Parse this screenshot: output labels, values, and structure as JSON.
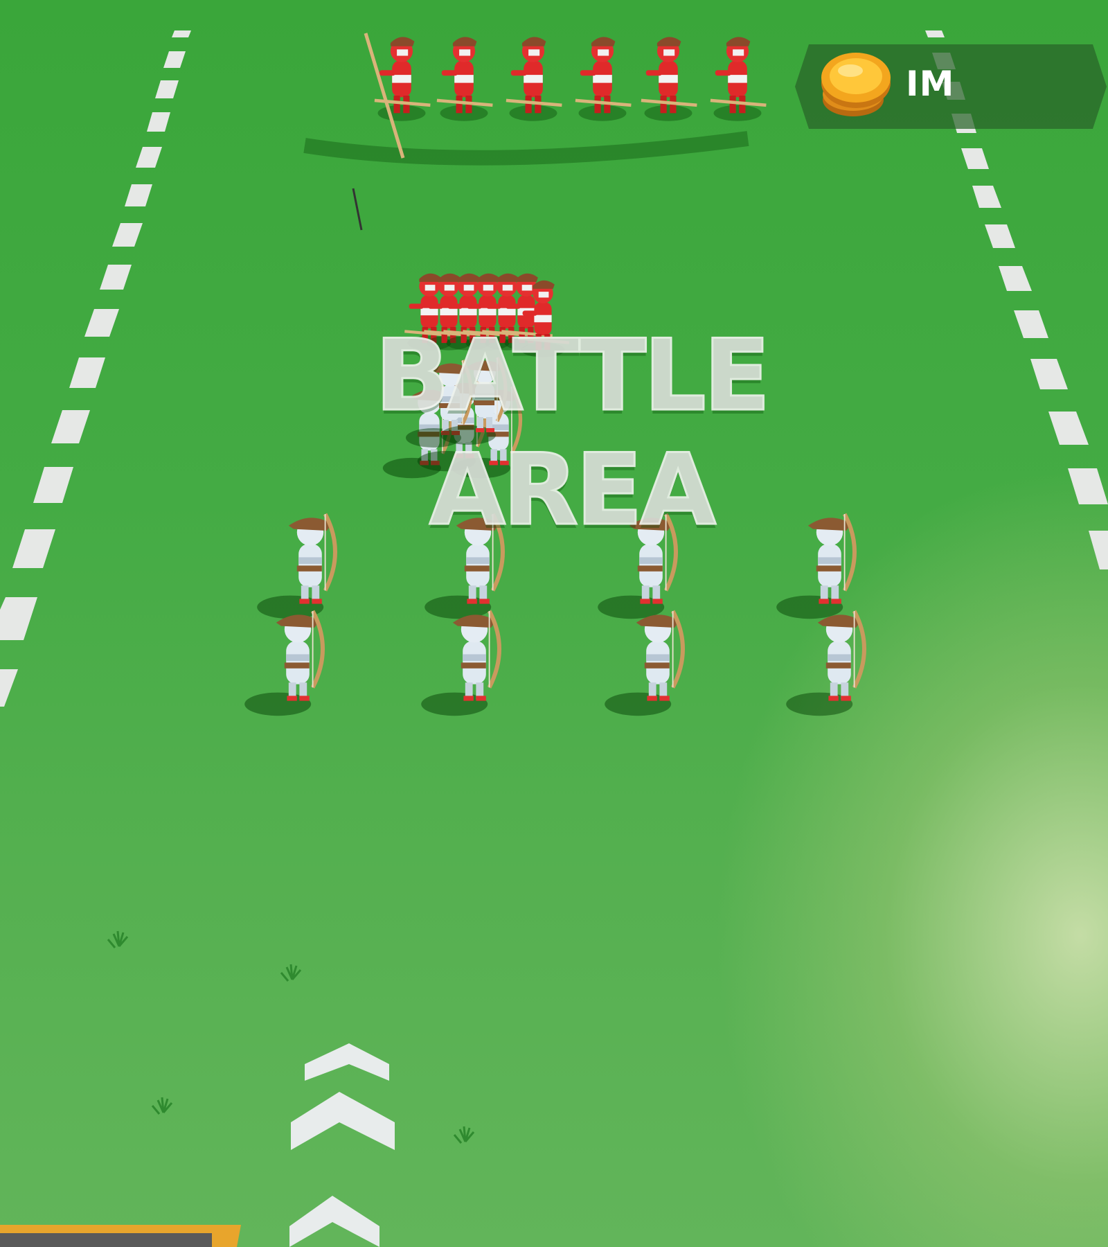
{
  "hud": {
    "coins": {
      "icon": "coin-stack-icon",
      "amount": "IM"
    }
  },
  "field": {
    "label": "BATTLE AREA",
    "advance_arrows": "chevron-up-icon"
  },
  "armies": {
    "enemy": {
      "color": "#e02a2a",
      "unit": "archer"
    },
    "player": {
      "color": "#d8e4ee",
      "unit": "archer"
    }
  },
  "colors": {
    "grass": "#44ab44",
    "lane_line": "#e6e8e6",
    "hud_bg": "#2c6a2c",
    "coin": "#f2a51f",
    "bottom_bar": "#e8a52c"
  }
}
